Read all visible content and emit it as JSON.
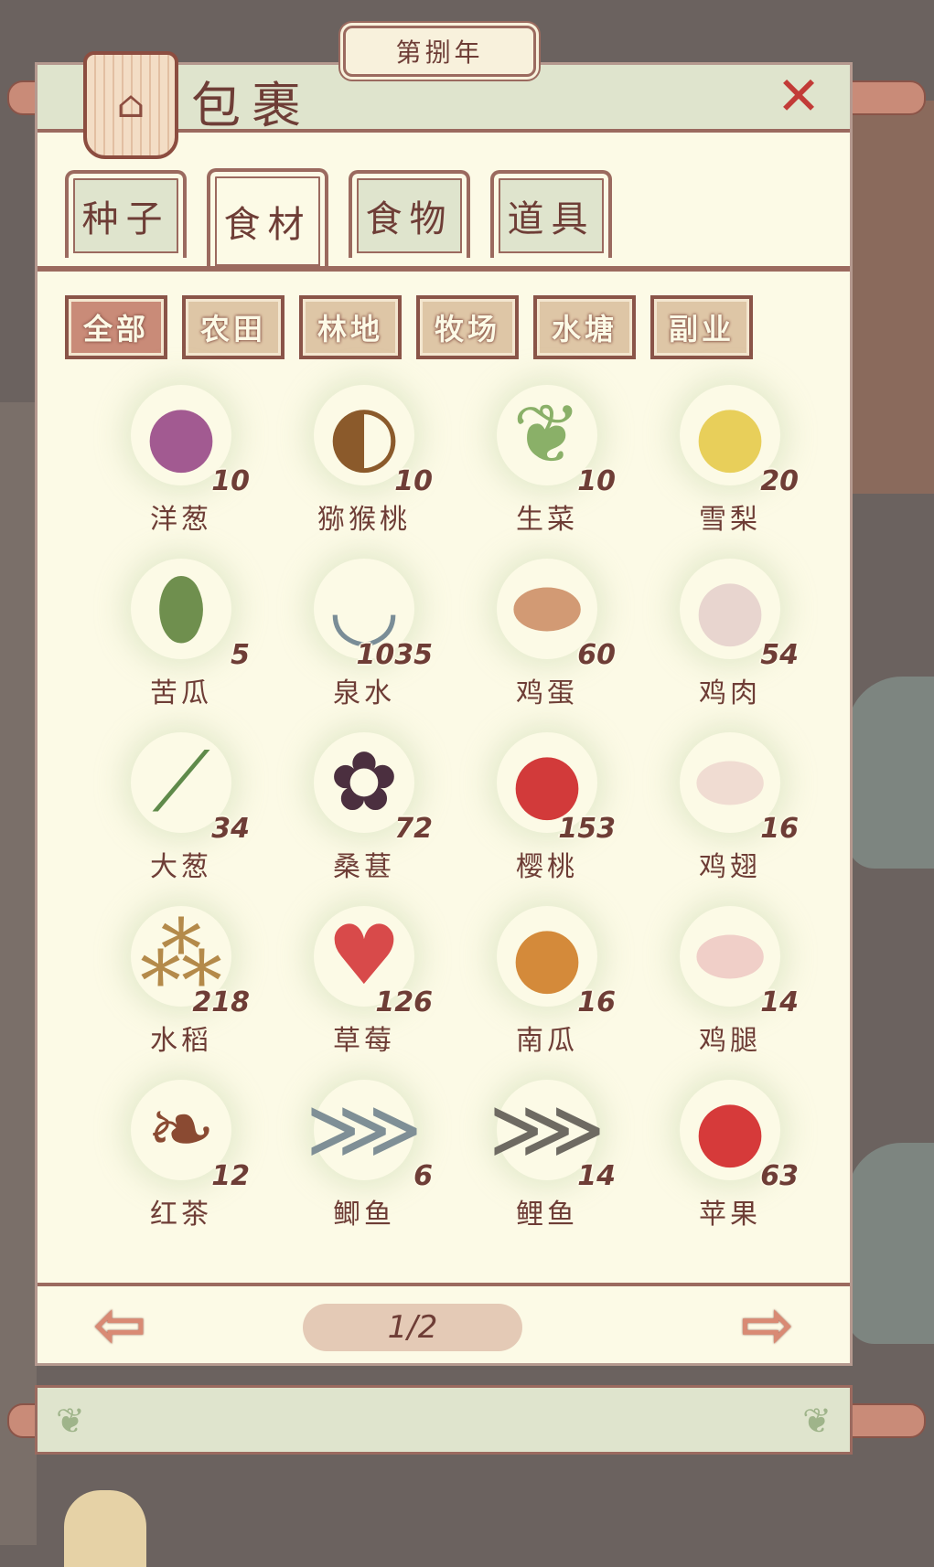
{
  "year_label": "第捌年",
  "title": "包裹",
  "close_glyph": "✕",
  "tabs": [
    {
      "label": "种子"
    },
    {
      "label": "食材"
    },
    {
      "label": "食物"
    },
    {
      "label": "道具"
    }
  ],
  "active_tab": "食材",
  "filters": [
    {
      "label": "全部"
    },
    {
      "label": "农田"
    },
    {
      "label": "林地"
    },
    {
      "label": "牧场"
    },
    {
      "label": "水塘"
    },
    {
      "label": "副业"
    }
  ],
  "active_filter": "全部",
  "items": [
    {
      "name": "洋葱",
      "qty": "10",
      "icon": "onion-icon",
      "color": "#a25a91",
      "glyph": "●"
    },
    {
      "name": "猕猴桃",
      "qty": "10",
      "icon": "kiwi-icon",
      "color": "#8b5a2b",
      "glyph": "◐"
    },
    {
      "name": "生菜",
      "qty": "10",
      "icon": "lettuce-icon",
      "color": "#8ab068",
      "glyph": "❦"
    },
    {
      "name": "雪梨",
      "qty": "20",
      "icon": "pear-icon",
      "color": "#e8cf5a",
      "glyph": "●"
    },
    {
      "name": "苦瓜",
      "qty": "5",
      "icon": "bitter-melon-icon",
      "color": "#6f8f4e",
      "glyph": "⬮"
    },
    {
      "name": "泉水",
      "qty": "1035",
      "icon": "water-bowl-icon",
      "color": "#7a8d97",
      "glyph": "◡"
    },
    {
      "name": "鸡蛋",
      "qty": "60",
      "icon": "egg-icon",
      "color": "#d29a74",
      "glyph": "⬬"
    },
    {
      "name": "鸡肉",
      "qty": "54",
      "icon": "chicken-icon",
      "color": "#e8d5cf",
      "glyph": "●"
    },
    {
      "name": "大葱",
      "qty": "34",
      "icon": "green-onion-icon",
      "color": "#5f8a4a",
      "glyph": "⟋"
    },
    {
      "name": "桑葚",
      "qty": "72",
      "icon": "mulberry-icon",
      "color": "#4b2f3f",
      "glyph": "✿"
    },
    {
      "name": "樱桃",
      "qty": "153",
      "icon": "cherry-icon",
      "color": "#d23a3a",
      "glyph": "●"
    },
    {
      "name": "鸡翅",
      "qty": "16",
      "icon": "chicken-wing-icon",
      "color": "#f0dcd2",
      "glyph": "⬬"
    },
    {
      "name": "水稻",
      "qty": "218",
      "icon": "rice-icon",
      "color": "#b48a4a",
      "glyph": "⁂"
    },
    {
      "name": "草莓",
      "qty": "126",
      "icon": "strawberry-icon",
      "color": "#d84a4a",
      "glyph": "♥"
    },
    {
      "name": "南瓜",
      "qty": "16",
      "icon": "pumpkin-icon",
      "color": "#d48a3a",
      "glyph": "●"
    },
    {
      "name": "鸡腿",
      "qty": "14",
      "icon": "chicken-leg-icon",
      "color": "#f0cfc8",
      "glyph": "⬬"
    },
    {
      "name": "红茶",
      "qty": "12",
      "icon": "tea-leaf-icon",
      "color": "#8a4a32",
      "glyph": "❧"
    },
    {
      "name": "鲫鱼",
      "qty": "6",
      "icon": "crucian-fish-icon",
      "color": "#7f8f96",
      "glyph": "⋙"
    },
    {
      "name": "鲤鱼",
      "qty": "14",
      "icon": "carp-icon",
      "color": "#6e6a62",
      "glyph": "⋙"
    },
    {
      "name": "苹果",
      "qty": "63",
      "icon": "apple-icon",
      "color": "#d63a3a",
      "glyph": "●"
    }
  ],
  "pagination": {
    "label": "1/2",
    "prev_glyph": "⇦",
    "next_glyph": "⇨"
  }
}
